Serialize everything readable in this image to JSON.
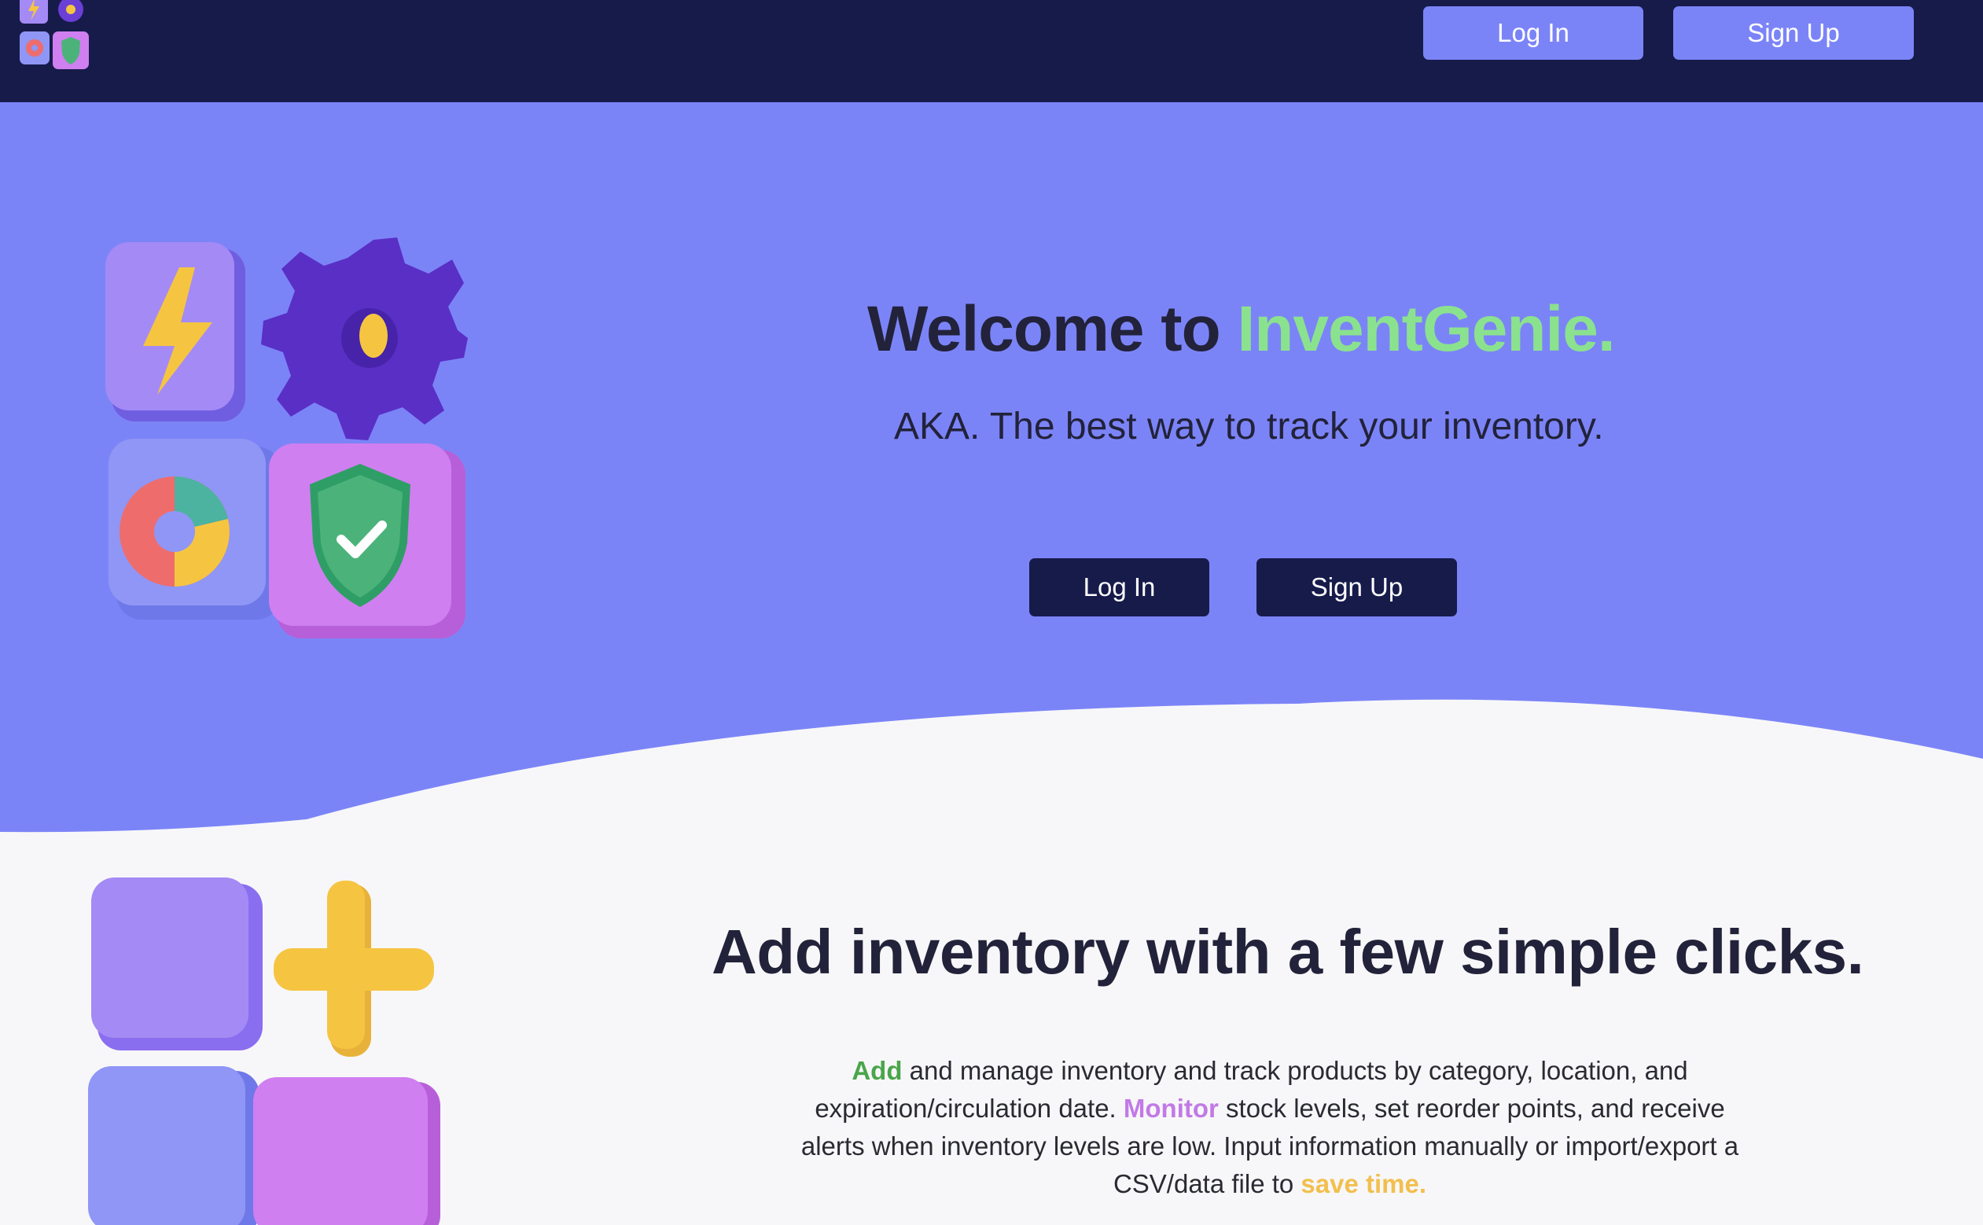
{
  "nav": {
    "login_label": "Log In",
    "signup_label": "Sign Up"
  },
  "hero": {
    "title_prefix": "Welcome to ",
    "title_brand": "InventGenie.",
    "subtitle": "AKA. The best way to track your inventory.",
    "login_label": "Log In",
    "signup_label": "Sign Up"
  },
  "features": {
    "title": "Add inventory with a few simple clicks.",
    "body": {
      "hl1": "Add",
      "t1": " and manage inventory and track products by category, location, and expiration/circulation date. ",
      "hl2": "Monitor",
      "t2": " stock levels, set reorder points, and receive alerts when inventory levels are low. Input information manually or import/export a CSV/data file to ",
      "hl3": "save time."
    }
  },
  "colors": {
    "navbar": "#171b4a",
    "hero_bg": "#7b84f7",
    "brand_green": "#8be28e",
    "page_bg": "#f7f7f9",
    "highlight_green": "#4aa54a",
    "highlight_purple": "#c27ae6",
    "highlight_yellow": "#f2bf4e"
  },
  "icons": {
    "logo": "app-icons-logo",
    "hero_illustration": [
      "lightning-icon",
      "gear-icon",
      "pie-chart-icon",
      "shield-check-icon"
    ],
    "features_illustration": [
      "purple-block",
      "plus-icon",
      "blue-block",
      "pink-block"
    ]
  }
}
